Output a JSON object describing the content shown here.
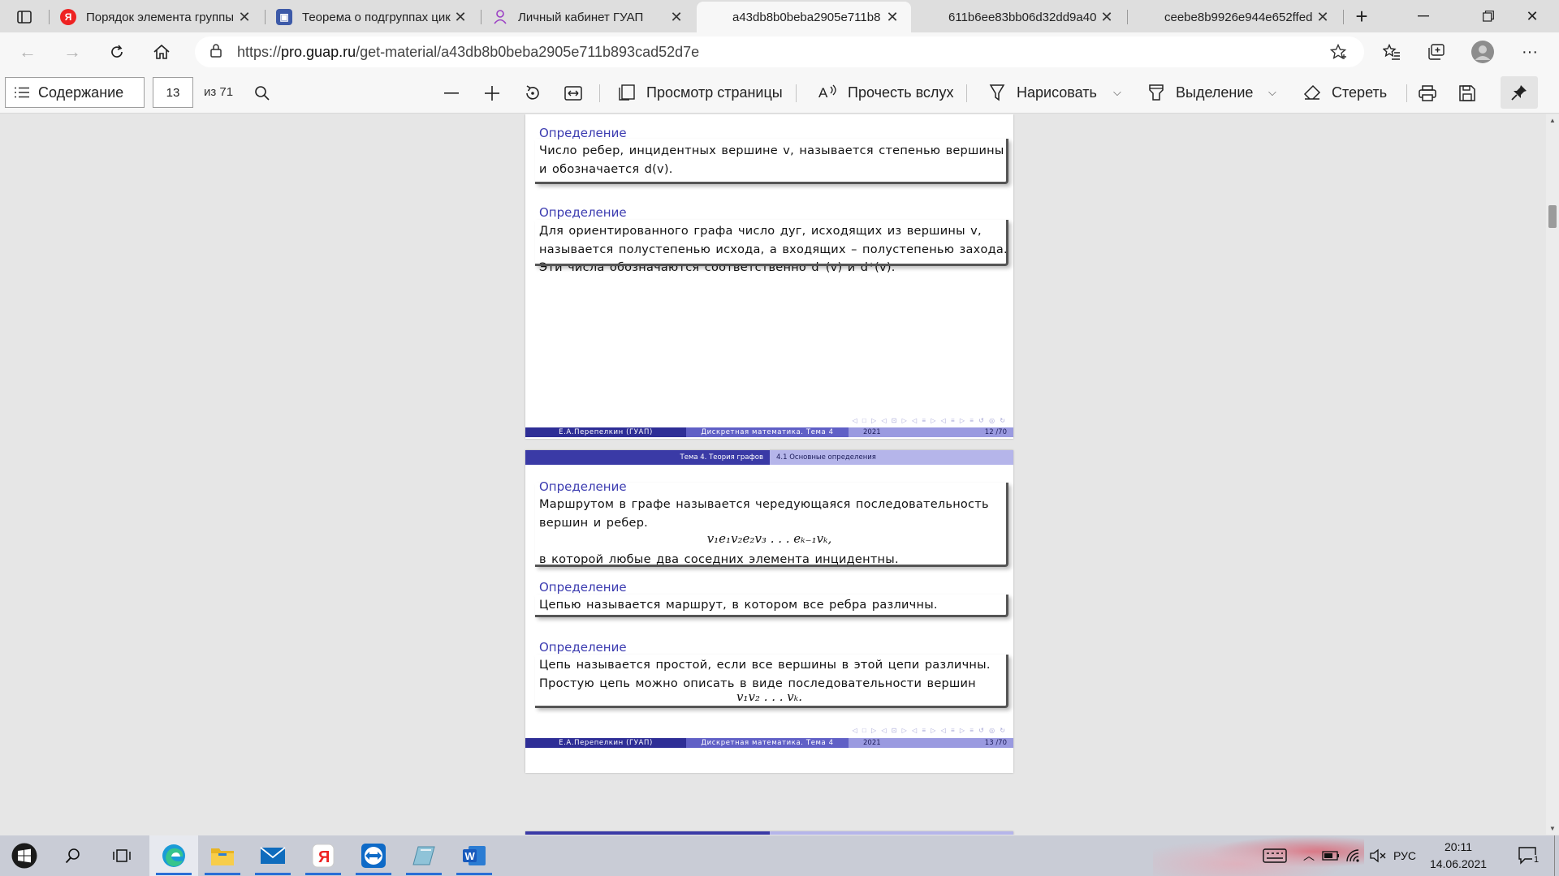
{
  "browser": {
    "tabs": [
      {
        "title": "Порядок элемента группы",
        "favicon": "yandex-icon",
        "active": false
      },
      {
        "title": "Теорема о подгруппах цик",
        "favicon": "site-icon",
        "active": false
      },
      {
        "title": "Личный кабинет ГУАП",
        "favicon": "person-icon",
        "active": false
      },
      {
        "title": "a43db8b0beba2905e711b8",
        "favicon": "none",
        "active": true
      },
      {
        "title": "611b6ee83bb06d32dd9a40",
        "favicon": "none",
        "active": false
      },
      {
        "title": "ceebe8b9926e944e652ffed",
        "favicon": "none",
        "active": false
      }
    ],
    "new_tab_label": "+",
    "url_prefix": "https://",
    "url_host": "pro.guap.ru",
    "url_path": "/get-material/a43db8b0beba2905e711b893cad52d7e"
  },
  "pdf_toolbar": {
    "contents_label": "Содержание",
    "page_number": "13",
    "page_total": "из 71",
    "page_view_label": "Просмотр страницы",
    "read_aloud_label": "Прочесть вслух",
    "draw_label": "Нарисовать",
    "highlight_label": "Выделение",
    "erase_label": "Стереть"
  },
  "slide12": {
    "def1_title": "Определение",
    "def1_line1": "Число ребер, инцидентных вершине v, называется степенью вершины",
    "def1_line2": "и обозначается d(v).",
    "def2_title": "Определение",
    "def2_line1": "Для ориентированного графа число дуг, исходящих из вершины v,",
    "def2_line2": "называется полустепенью исхода, а входящих – полустепенью захода.",
    "def2_line3": "Эти числа обозначаются соответственно d⁻(v) и d⁺(v).",
    "footer_author": "Е.А.Перепелкин (ГУАП)",
    "footer_course": "Дискретная математика. Тема 4",
    "footer_year": "2021",
    "footer_page": "12 /70"
  },
  "slide13": {
    "header_left": "Тема 4. Теория графов",
    "header_right": "4.1 Основные определения",
    "def1_title": "Определение",
    "def1_line1": "Маршрутом в графе называется чередующаяся последовательность",
    "def1_line2": "вершин и ребер.",
    "def1_formula": "v₁e₁v₂e₂v₃ . . . eₖ₋₁vₖ,",
    "def1_line3": "в которой любые два соседних элемента инцидентны.",
    "def2_title": "Определение",
    "def2_line1": "Цепью называется маршрут, в котором все ребра различны.",
    "def3_title": "Определение",
    "def3_line1": "Цепь называется простой, если все вершины в этой цепи различны.",
    "def3_line2": "Простую цепь можно описать в виде последовательности вершин",
    "def3_formula": "v₁v₂ . . . vₖ.",
    "footer_author": "Е.А.Перепелкин (ГУАП)",
    "footer_course": "Дискретная математика. Тема 4",
    "footer_year": "2021",
    "footer_page": "13 /70"
  },
  "taskbar": {
    "lang": "РУС",
    "time": "20:11",
    "date": "14.06.2021",
    "notification_count": "1"
  },
  "colors": {
    "beamer_dark": "#2e2e96",
    "beamer_mid": "#6060c6",
    "beamer_light": "#9a9ae0",
    "block_title": "#3b3bb0"
  }
}
